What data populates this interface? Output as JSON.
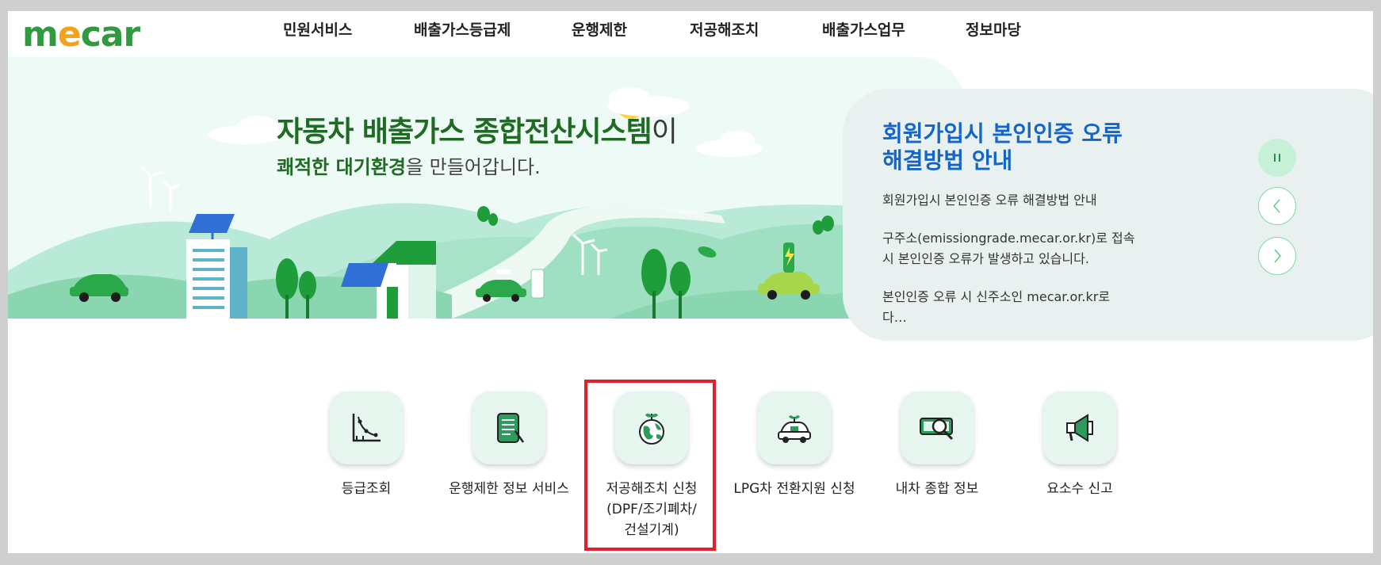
{
  "logo": {
    "text_m": "m",
    "text_e": "e",
    "text_car": "car"
  },
  "gnb": [
    {
      "label": "민원서비스"
    },
    {
      "label": "배출가스등급제"
    },
    {
      "label": "운행제한"
    },
    {
      "label": "저공해조치"
    },
    {
      "label": "배출가스업무"
    },
    {
      "label": "정보마당"
    }
  ],
  "hero": {
    "title_strong": "자동차 배출가스 종합전산시스템",
    "title_rest": "이",
    "sub_strong": "쾌적한 대기환경",
    "sub_rest": "을 만들어갑니다."
  },
  "notice": {
    "title": "회원가입시 본인인증 오류 해결방법 안내",
    "lines": [
      "회원가입시 본인인증 오류 해결방법 안내",
      "구주소(emissiongrade.mecar.or.kr)로 접속시 본인인증 오류가 발생하고 있습니다.",
      "본인인증 오류 시 신주소인 mecar.or.kr로 다…"
    ],
    "controls": {
      "pause": "II",
      "prev": "‹",
      "next": "›"
    }
  },
  "services": [
    {
      "label": "등급조회",
      "icon": "grade-chart-icon"
    },
    {
      "label": "운행제한 정보 서비스",
      "icon": "tablet-info-icon"
    },
    {
      "label": "저공해조치 신청\n(DPF/조기폐차/\n건설기계)",
      "icon": "earth-sprout-icon"
    },
    {
      "label": "LPG차 전환지원 신청",
      "icon": "eco-car-icon"
    },
    {
      "label": "내차 종합 정보",
      "icon": "car-search-icon"
    },
    {
      "label": "요소수 신고",
      "icon": "megaphone-icon"
    }
  ],
  "colors": {
    "brand_green": "#1f6b24",
    "notice_blue": "#1565c8",
    "highlight_red": "#e0202a",
    "hero_bg": "#eefaf6"
  }
}
